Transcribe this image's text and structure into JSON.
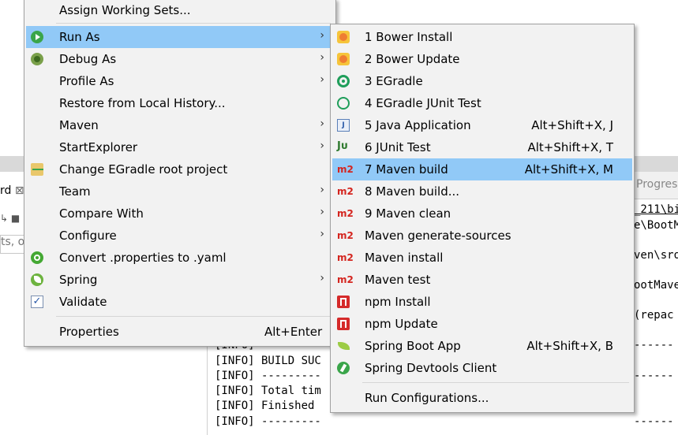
{
  "background": {
    "left_tab_label": "rd",
    "left_filter_text": "ts, o",
    "progress_tab_label": "Progres",
    "right_lines": [
      "_211\\bi",
      "e\\BootM",
      "ven\\sro",
      "ootMave",
      "(repac"
    ],
    "console_lines": [
      "[INFO] ---------",
      "[INFO] BUILD SUC",
      "[INFO] ---------",
      "[INFO] Total tim",
      "[INFO] Finished",
      "[INFO] ---------"
    ],
    "console_right_dashes": [
      "------",
      "------",
      "------"
    ]
  },
  "context_menu": {
    "items": [
      {
        "label": "Assign Working Sets...",
        "icon": "",
        "submenu": false
      },
      {
        "label": "Run As",
        "icon": "run-icon",
        "submenu": true,
        "highlighted": true
      },
      {
        "label": "Debug As",
        "icon": "debug-icon",
        "submenu": true
      },
      {
        "label": "Profile As",
        "icon": "",
        "submenu": true
      },
      {
        "label": "Restore from Local History...",
        "icon": "",
        "submenu": false
      },
      {
        "label": "Maven",
        "icon": "",
        "submenu": true
      },
      {
        "label": "StartExplorer",
        "icon": "",
        "submenu": true
      },
      {
        "label": "Change EGradle root project",
        "icon": "folder-icon",
        "submenu": false
      },
      {
        "label": "Team",
        "icon": "",
        "submenu": true
      },
      {
        "label": "Compare With",
        "icon": "",
        "submenu": true
      },
      {
        "label": "Configure",
        "icon": "",
        "submenu": true
      },
      {
        "label": "Convert .properties to .yaml",
        "icon": "power-icon",
        "submenu": false
      },
      {
        "label": "Spring",
        "icon": "spring-icon",
        "submenu": true
      },
      {
        "label": "Validate",
        "icon": "check-icon",
        "submenu": false
      },
      {
        "label": "Properties",
        "icon": "",
        "submenu": false,
        "accelerator": "Alt+Enter"
      }
    ]
  },
  "run_as_submenu": {
    "items": [
      {
        "label": "1 Bower Install",
        "icon": "bower-icon"
      },
      {
        "label": "2 Bower Update",
        "icon": "bower-icon"
      },
      {
        "label": "3 EGradle",
        "icon": "egradle-icon"
      },
      {
        "label": "4 EGradle JUnit Test",
        "icon": "egradle-junit-icon"
      },
      {
        "label": "5 Java Application",
        "icon": "java-app-icon",
        "accelerator": "Alt+Shift+X, J"
      },
      {
        "label": "6 JUnit Test",
        "icon": "junit-icon",
        "accelerator": "Alt+Shift+X, T"
      },
      {
        "label": "7 Maven build",
        "icon": "m2-icon",
        "accelerator": "Alt+Shift+X, M",
        "highlighted": true
      },
      {
        "label": "8 Maven build...",
        "icon": "m2-icon"
      },
      {
        "label": "9 Maven clean",
        "icon": "m2-icon"
      },
      {
        "label": "Maven generate-sources",
        "icon": "m2-icon"
      },
      {
        "label": "Maven install",
        "icon": "m2-icon"
      },
      {
        "label": "Maven test",
        "icon": "m2-icon"
      },
      {
        "label": "npm Install",
        "icon": "npm-icon"
      },
      {
        "label": "npm Update",
        "icon": "npm-icon"
      },
      {
        "label": "Spring Boot App",
        "icon": "spring-boot-icon",
        "accelerator": "Alt+Shift+X, B"
      },
      {
        "label": "Spring Devtools Client",
        "icon": "devtools-icon"
      },
      {
        "label": "Run Configurations...",
        "icon": ""
      }
    ]
  },
  "icon_text": {
    "m2": "m2",
    "java": "J",
    "junit": "Jᴜ",
    "check": "✓",
    "arrow": "›"
  }
}
